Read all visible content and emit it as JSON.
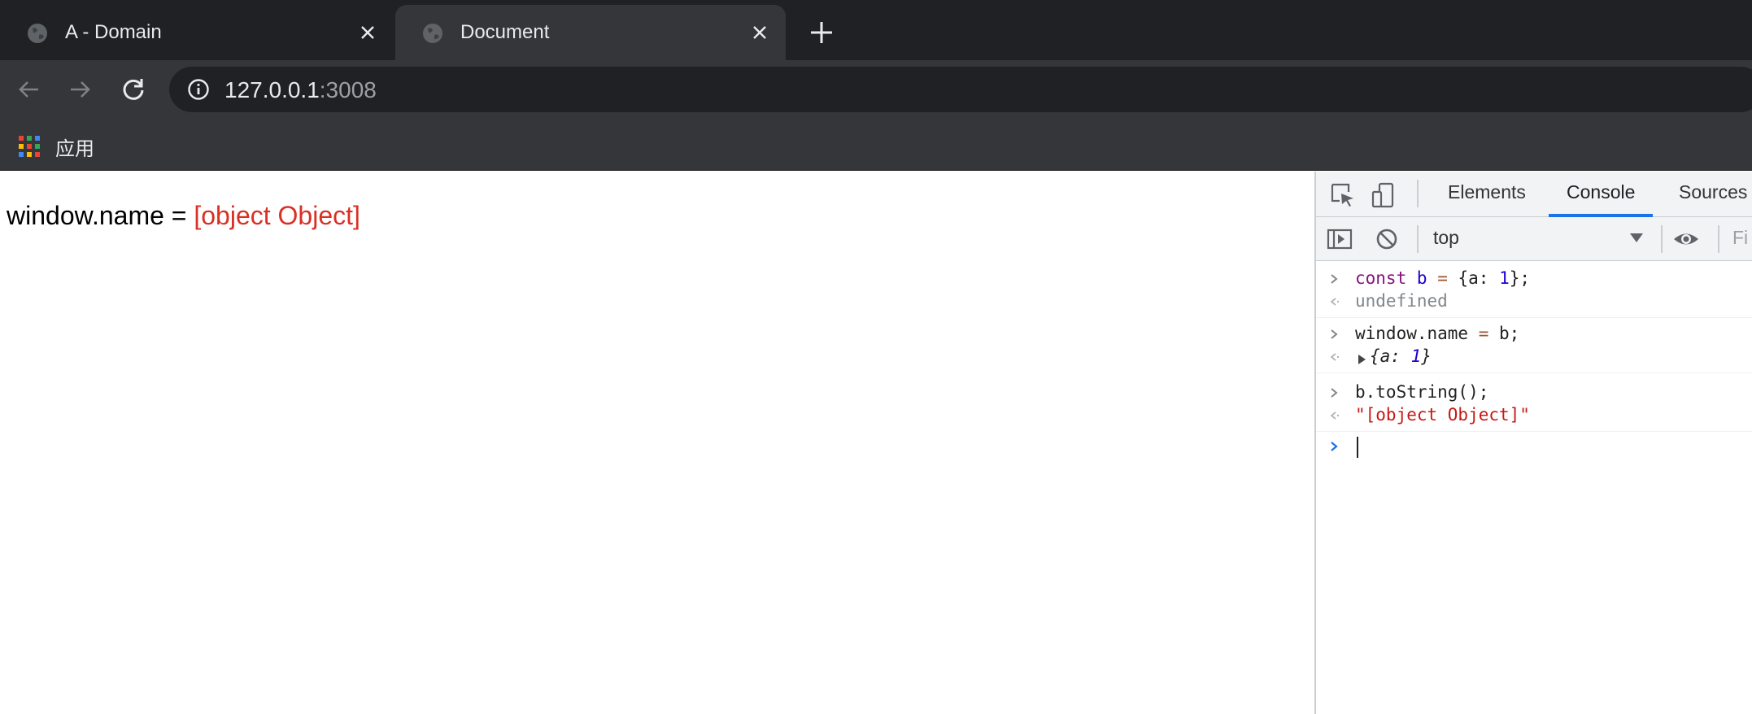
{
  "tabs": [
    {
      "title": "A - Domain",
      "active": false
    },
    {
      "title": "Document",
      "active": true
    }
  ],
  "toolbar": {
    "url_host": "127.0.0.1",
    "url_port": ":3008"
  },
  "bookmarks": {
    "apps_label": "应用"
  },
  "page": {
    "label": "window.name = ",
    "value": "[object Object]"
  },
  "devtools": {
    "tabs": [
      "Elements",
      "Console",
      "Sources"
    ],
    "active_tab": "Console",
    "context": "top",
    "filter_placeholder": "Fi",
    "console": [
      {
        "type": "input",
        "text": "const b = {a: 1};"
      },
      {
        "type": "output",
        "text": "undefined"
      },
      {
        "type": "input",
        "text": "window.name = b;"
      },
      {
        "type": "output",
        "text": "{a: 1}"
      },
      {
        "type": "input",
        "text": "b.toString();"
      },
      {
        "type": "output",
        "text": "\"[object Object]\""
      }
    ]
  },
  "colors": {
    "tabstrip_bg": "#202124",
    "toolbar_bg": "#35363a",
    "error_red": "#d93025",
    "devtools_accent": "#1a73e8"
  },
  "icons": {
    "tab_favicon": "globe-icon",
    "tab_close": "close-icon",
    "new_tab": "plus-icon",
    "back": "arrow-left-icon",
    "forward": "arrow-right-icon",
    "reload": "reload-icon",
    "site_info": "info-icon",
    "apps": "apps-grid-icon",
    "inspect": "inspect-element-icon",
    "device": "device-toolbar-icon",
    "sidebar": "show-sidebar-icon",
    "clear": "clear-console-icon",
    "eye": "live-expression-icon"
  }
}
